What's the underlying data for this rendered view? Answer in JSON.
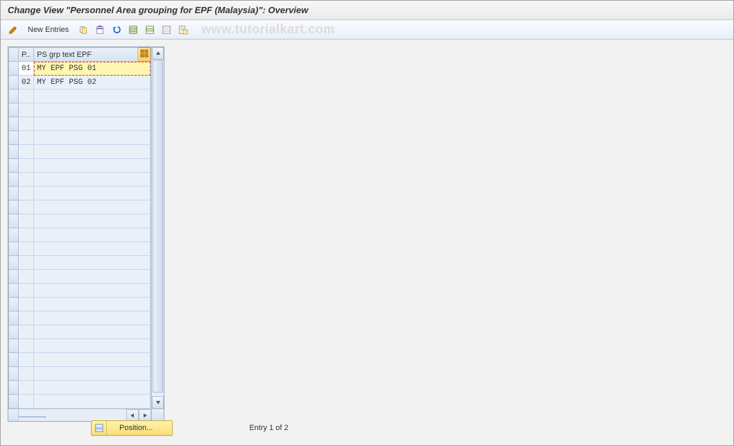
{
  "header": {
    "title": "Change View \"Personnel Area grouping for EPF (Malaysia)\": Overview"
  },
  "toolbar": {
    "new_entries_label": "New Entries"
  },
  "watermark": "www.tutorialkart.com",
  "table": {
    "columns": {
      "p": "P..",
      "text": "PS grp text EPF"
    },
    "rows": [
      {
        "p": "01",
        "text": "MY EPF PSG 01",
        "active": true
      },
      {
        "p": "02",
        "text": "MY EPF PSG 02",
        "active": false
      }
    ],
    "empty_row_count": 23
  },
  "footer": {
    "position_label": "Position...",
    "entry_text": "Entry 1 of 2"
  }
}
